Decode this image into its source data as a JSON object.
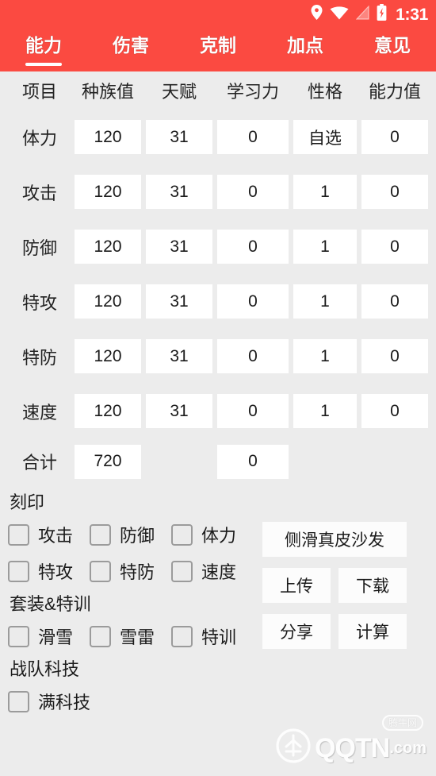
{
  "colors": {
    "brand_red": "#fb4a41",
    "page_bg": "#ececec",
    "field_bg": "#ffffff",
    "text": "#1b1b1b"
  },
  "statusbar": {
    "time": "1:31",
    "icons": [
      "location-pin-icon",
      "wifi-icon",
      "signal-icon",
      "battery-charging-icon"
    ]
  },
  "tabs": [
    {
      "label": "能力",
      "active": true
    },
    {
      "label": "伤害",
      "active": false
    },
    {
      "label": "克制",
      "active": false
    },
    {
      "label": "加点",
      "active": false
    },
    {
      "label": "意见",
      "active": false
    }
  ],
  "stats_table": {
    "headers": [
      "项目",
      "种族值",
      "天赋",
      "学习力",
      "性格",
      "能力值"
    ],
    "rows": [
      {
        "label": "体力",
        "base": "120",
        "iv": "31",
        "ev": "0",
        "nature": "自选",
        "stat": "0"
      },
      {
        "label": "攻击",
        "base": "120",
        "iv": "31",
        "ev": "0",
        "nature": "1",
        "stat": "0"
      },
      {
        "label": "防御",
        "base": "120",
        "iv": "31",
        "ev": "0",
        "nature": "1",
        "stat": "0"
      },
      {
        "label": "特攻",
        "base": "120",
        "iv": "31",
        "ev": "0",
        "nature": "1",
        "stat": "0"
      },
      {
        "label": "特防",
        "base": "120",
        "iv": "31",
        "ev": "0",
        "nature": "1",
        "stat": "0"
      },
      {
        "label": "速度",
        "base": "120",
        "iv": "31",
        "ev": "0",
        "nature": "1",
        "stat": "0"
      }
    ],
    "total": {
      "label": "合计",
      "base": "720",
      "ev": "0"
    }
  },
  "engrave": {
    "title": "刻印",
    "row1": [
      {
        "label": "攻击",
        "checked": false
      },
      {
        "label": "防御",
        "checked": false
      },
      {
        "label": "体力",
        "checked": false
      }
    ],
    "row2": [
      {
        "label": "特攻",
        "checked": false
      },
      {
        "label": "特防",
        "checked": false
      },
      {
        "label": "速度",
        "checked": false
      }
    ]
  },
  "suit_training": {
    "title": "套装&特训",
    "items": [
      {
        "label": "滑雪",
        "checked": false
      },
      {
        "label": "雪雷",
        "checked": false
      },
      {
        "label": "特训",
        "checked": false
      }
    ]
  },
  "team_tech": {
    "title": "战队科技",
    "items": [
      {
        "label": "满科技",
        "checked": false
      }
    ]
  },
  "buttons": {
    "wide": "侧滑真皮沙发",
    "upload": "上传",
    "download": "下载",
    "share": "分享",
    "calculate": "计算"
  },
  "watermark": {
    "name": "QQTN",
    "suffix": ".com",
    "badge": "腾牛网"
  }
}
